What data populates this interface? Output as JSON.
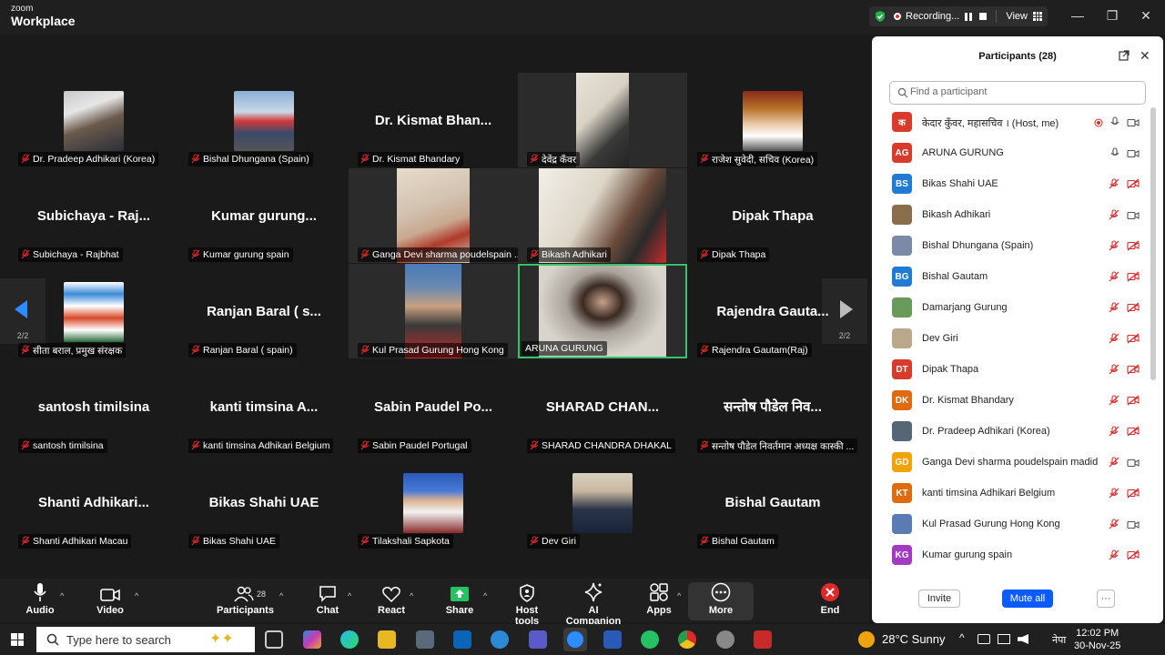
{
  "app": {
    "logo_line1": "zoom",
    "logo_line2": "Workplace",
    "recording_label": "Recording...",
    "view_label": "View",
    "win_min": "—",
    "win_max": "❐",
    "win_close": "✕"
  },
  "pagination": {
    "left": "2/2",
    "right": "2/2"
  },
  "tiles": [
    {
      "label": "Dr. Pradeep Adhikari (Korea)",
      "name": "",
      "type": "pic"
    },
    {
      "label": "Bishal Dhungana (Spain)",
      "name": "",
      "type": "pic"
    },
    {
      "label": "Dr. Kismat Bhandary",
      "name": "Dr. Kismat Bhan...",
      "type": "name"
    },
    {
      "label": "देवेंद्र कँवर",
      "name": "",
      "type": "video"
    },
    {
      "label": "राजेश सुवेदी, सचिव (Korea)",
      "name": "",
      "type": "pic"
    },
    {
      "label": "Subichaya - Rajbhat",
      "name": "Subichaya - Raj...",
      "type": "name"
    },
    {
      "label": "Kumar gurung  spain",
      "name": "Kumar gurung...",
      "type": "name"
    },
    {
      "label": "Ganga Devi sharma poudelspain ...",
      "name": "",
      "type": "video"
    },
    {
      "label": "Bikash Adhikari",
      "name": "",
      "type": "video"
    },
    {
      "label": "Dipak Thapa",
      "name": "Dipak Thapa",
      "type": "name"
    },
    {
      "label": "सीता बराल, प्रमुख संरक्षक",
      "name": "",
      "type": "pic"
    },
    {
      "label": "Ranjan Baral ( spain)",
      "name": "Ranjan Baral ( s...",
      "type": "name"
    },
    {
      "label": "Kul Prasad Gurung Hong Kong",
      "name": "",
      "type": "video"
    },
    {
      "label": "ARUNA GURUNG",
      "name": "",
      "type": "video"
    },
    {
      "label": "Rajendra Gautam(Raj)",
      "name": "Rajendra Gauta...",
      "type": "name"
    },
    {
      "label": "santosh timilsina",
      "name": "santosh timilsina",
      "type": "name"
    },
    {
      "label": "kanti timsina Adhikari Belgium",
      "name": "kanti timsina A...",
      "type": "name"
    },
    {
      "label": "Sabin Paudel Portugal",
      "name": "Sabin Paudel Po...",
      "type": "name"
    },
    {
      "label": "SHARAD CHANDRA DHAKAL",
      "name": "SHARAD CHAN...",
      "type": "name"
    },
    {
      "label": "सन्तोष पौडेल निवर्तमान अध्यक्ष कास्की ...",
      "name": "सन्तोष पौडेल निव...",
      "type": "name"
    },
    {
      "label": "Shanti Adhikari Macau",
      "name": "Shanti  Adhikari...",
      "type": "name"
    },
    {
      "label": "Bikas Shahi UAE",
      "name": "Bikas Shahi UAE",
      "type": "name"
    },
    {
      "label": "Tilakshali Sapkota",
      "name": "",
      "type": "pic"
    },
    {
      "label": "Dev Giri",
      "name": "",
      "type": "pic"
    },
    {
      "label": "Bishal Gautam",
      "name": "Bishal Gautam",
      "type": "name"
    }
  ],
  "toolbar": {
    "audio": "Audio",
    "video": "Video",
    "participants": "Participants",
    "participants_count": "28",
    "chat": "Chat",
    "react": "React",
    "share": "Share",
    "host_tools": "Host tools",
    "ai_companion": "AI Companion",
    "apps": "Apps",
    "more": "More",
    "end": "End"
  },
  "panel": {
    "title": "Participants (28)",
    "search_placeholder": "Find a participant",
    "invite": "Invite",
    "mute_all": "Mute all",
    "more": "···",
    "participants": [
      {
        "initials": "क",
        "name": "केदार कुँवर, महासचिव । (Host, me)",
        "color": "#d83b2b",
        "mic": "on",
        "cam": "off-plain",
        "rec": true
      },
      {
        "initials": "AG",
        "name": "ARUNA GURUNG",
        "color": "#d83b2b",
        "mic": "on",
        "cam": "on"
      },
      {
        "initials": "BS",
        "name": "Bikas Shahi UAE",
        "color": "#1f7bd4",
        "mic": "muted",
        "cam": "off"
      },
      {
        "initials": "",
        "name": "Bikash Adhikari",
        "color": "#8a6d4a",
        "mic": "muted",
        "cam": "on"
      },
      {
        "initials": "",
        "name": "Bishal Dhungana (Spain)",
        "color": "#7a8aa8",
        "mic": "muted",
        "cam": "off"
      },
      {
        "initials": "BG",
        "name": "Bishal Gautam",
        "color": "#1f7bd4",
        "mic": "muted",
        "cam": "off"
      },
      {
        "initials": "",
        "name": "Damarjang Gurung",
        "color": "#6a9a5a",
        "mic": "muted",
        "cam": "off"
      },
      {
        "initials": "",
        "name": "Dev Giri",
        "color": "#b9a98a",
        "mic": "muted",
        "cam": "off"
      },
      {
        "initials": "DT",
        "name": "Dipak Thapa",
        "color": "#d83b2b",
        "mic": "muted",
        "cam": "off"
      },
      {
        "initials": "DK",
        "name": "Dr. Kismat Bhandary",
        "color": "#e06a10",
        "mic": "muted",
        "cam": "off"
      },
      {
        "initials": "",
        "name": "Dr. Pradeep Adhikari (Korea)",
        "color": "#556677",
        "mic": "muted",
        "cam": "off"
      },
      {
        "initials": "GD",
        "name": "Ganga Devi sharma poudelspain madid",
        "color": "#f0a30a",
        "mic": "muted",
        "cam": "on"
      },
      {
        "initials": "KT",
        "name": "kanti timsina Adhikari Belgium",
        "color": "#e06a10",
        "mic": "muted",
        "cam": "off"
      },
      {
        "initials": "",
        "name": "Kul Prasad Gurung Hong Kong",
        "color": "#5a7bb4",
        "mic": "muted",
        "cam": "on"
      },
      {
        "initials": "KG",
        "name": "Kumar gurung  spain",
        "color": "#a33bc2",
        "mic": "muted",
        "cam": "off"
      }
    ]
  },
  "taskbar": {
    "search_placeholder": "Type here to search",
    "weather": "28°C  Sunny",
    "language": "नेपा",
    "time": "12:02 PM",
    "date": "30-Nov-25"
  },
  "colors": {
    "accent": "#0b5cff",
    "active_speaker": "#36c26a",
    "muted_red": "#e02828",
    "end_red": "#e02828",
    "share_green": "#24c262"
  }
}
